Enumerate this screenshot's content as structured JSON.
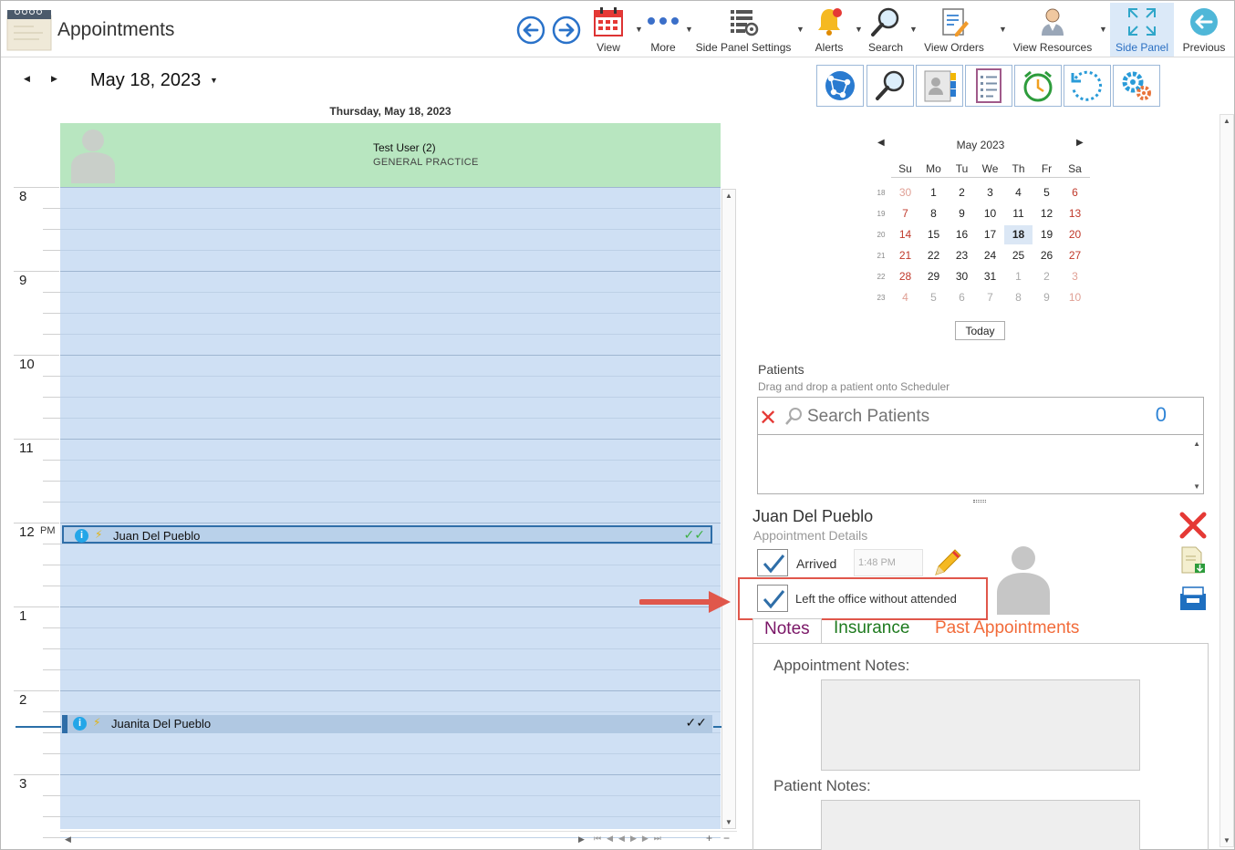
{
  "app": {
    "title": "Appointments"
  },
  "toolbar": {
    "view_label": "View",
    "more_label": "More",
    "side_panel_settings_label": "Side Panel Settings",
    "alerts_label": "Alerts",
    "search_label": "Search",
    "view_orders_label": "View Orders",
    "view_resources_label": "View Resources",
    "side_panel_label": "Side Panel",
    "previous_label": "Previous"
  },
  "scheduler": {
    "date_title": "May 18, 2023",
    "day_header": "Thursday, May 18, 2023",
    "resource": {
      "name": "Test User (2)",
      "department": "GENERAL PRACTICE"
    },
    "hours": [
      "8",
      "9",
      "10",
      "11",
      "12",
      "1",
      "2",
      "3"
    ],
    "pm_label": "PM",
    "appointments": [
      {
        "name": "Juan Del Pueblo",
        "checks": "✓✓",
        "check_color": "#3cb043",
        "selected": true
      },
      {
        "name": "Juanita Del Pueblo",
        "checks": "✓✓",
        "check_color": "#111111",
        "selected": false
      }
    ]
  },
  "mini_calendar": {
    "title": "May 2023",
    "weekdays": [
      "Su",
      "Mo",
      "Tu",
      "We",
      "Th",
      "Fr",
      "Sa"
    ],
    "weeks": [
      {
        "wk": "18",
        "days": [
          "30",
          "1",
          "2",
          "3",
          "4",
          "5",
          "6"
        ]
      },
      {
        "wk": "19",
        "days": [
          "7",
          "8",
          "9",
          "10",
          "11",
          "12",
          "13"
        ]
      },
      {
        "wk": "20",
        "days": [
          "14",
          "15",
          "16",
          "17",
          "18",
          "19",
          "20"
        ]
      },
      {
        "wk": "21",
        "days": [
          "21",
          "22",
          "23",
          "24",
          "25",
          "26",
          "27"
        ]
      },
      {
        "wk": "22",
        "days": [
          "28",
          "29",
          "30",
          "31",
          "1",
          "2",
          "3"
        ]
      },
      {
        "wk": "23",
        "days": [
          "4",
          "5",
          "6",
          "7",
          "8",
          "9",
          "10"
        ]
      }
    ],
    "selected_day": "18",
    "today_label": "Today"
  },
  "patients": {
    "title": "Patients",
    "hint": "Drag and drop a patient onto Scheduler",
    "search_placeholder": "Search Patients",
    "count": "0"
  },
  "details": {
    "patient_name": "Juan Del Pueblo",
    "subtitle": "Appointment Details",
    "arrived_label": "Arrived",
    "arrived_checked": true,
    "arrived_time": "1:48 PM",
    "left_label": "Left the office without attended",
    "left_checked": true,
    "tabs": [
      {
        "label": "Notes",
        "active": true
      },
      {
        "label": "Insurance",
        "active": false
      },
      {
        "label": "Past Appointments",
        "active": false
      }
    ],
    "appointment_notes_label": "Appointment Notes:",
    "patient_notes_label": "Patient Notes:"
  },
  "colors": {
    "accent": "#2f84d6",
    "resource_header": "#b8e6c0",
    "grid": "#cfe0f4",
    "highlight": "#e0574b",
    "delete": "#e53935"
  }
}
